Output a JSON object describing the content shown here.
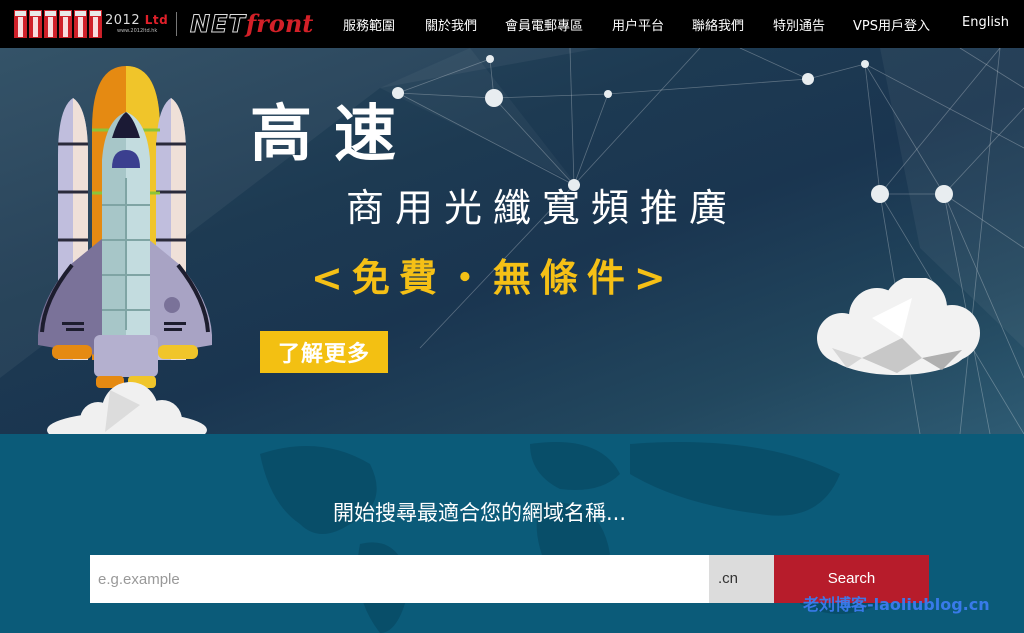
{
  "header": {
    "logo_text": "2012",
    "logo_suffix": "Ltd",
    "logo_url": "www.2012ltd.hk",
    "brand_net": "NET",
    "brand_front": "front",
    "nav": [
      {
        "label": "服務範圍"
      },
      {
        "label": "關於我們"
      },
      {
        "label": "會員電郵專區"
      },
      {
        "label": "用户平台"
      },
      {
        "label": "聯絡我們"
      },
      {
        "label": "特別通告"
      },
      {
        "label": "VPS用戶登入"
      },
      {
        "label": "English"
      }
    ]
  },
  "banner": {
    "headline_main": "高速",
    "headline_sub": "商用光纖寬頻推廣",
    "headline_offer": "<免費・無條件>",
    "cta_label": "了解更多",
    "accent_color": "#f3c012"
  },
  "search": {
    "title": "開始搜尋最適合您的網域名稱...",
    "input_placeholder": "e.g.example",
    "input_value": "",
    "tld_selected": ".cn",
    "button_label": "Search",
    "button_color": "#b71c2b"
  },
  "watermark": "老刘博客-laoliublog.cn"
}
